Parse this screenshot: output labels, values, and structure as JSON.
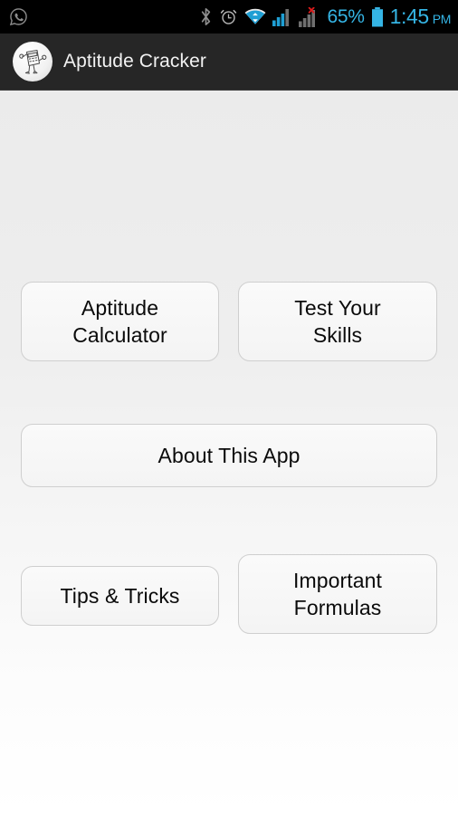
{
  "status_bar": {
    "notification_icon": "whatsapp-icon",
    "bluetooth_icon": "bluetooth-icon",
    "alarm_icon": "alarm-clock-icon",
    "wifi_icon": "wifi-icon",
    "signal_sim1_icon": "signal-bars-icon",
    "signal_sim2_icon": "signal-bars-no-service-icon",
    "battery_percent": "65%",
    "battery_icon": "battery-icon",
    "time": "1:45",
    "ampm": "PM",
    "accent_color": "#35b5e5",
    "background_color": "#000000"
  },
  "action_bar": {
    "icon": "app-logo-calculator-mascot-icon",
    "title": "Aptitude Cracker",
    "background_color": "#262626",
    "title_color": "#f2f2f2"
  },
  "content": {
    "background_top_color": "#ebebeb",
    "background_bottom_color": "#ffffff",
    "buttons": [
      {
        "id": "aptitude-calculator",
        "line1": "Aptitude",
        "line2": "Calculator"
      },
      {
        "id": "test-your-skills",
        "line1": "Test Your",
        "line2": "Skills"
      },
      {
        "id": "about-this-app",
        "line1": "About This App",
        "line2": ""
      },
      {
        "id": "tips-tricks",
        "line1": "Tips & Tricks",
        "line2": ""
      },
      {
        "id": "important-formulas",
        "line1": "Important",
        "line2": "Formulas"
      }
    ]
  }
}
